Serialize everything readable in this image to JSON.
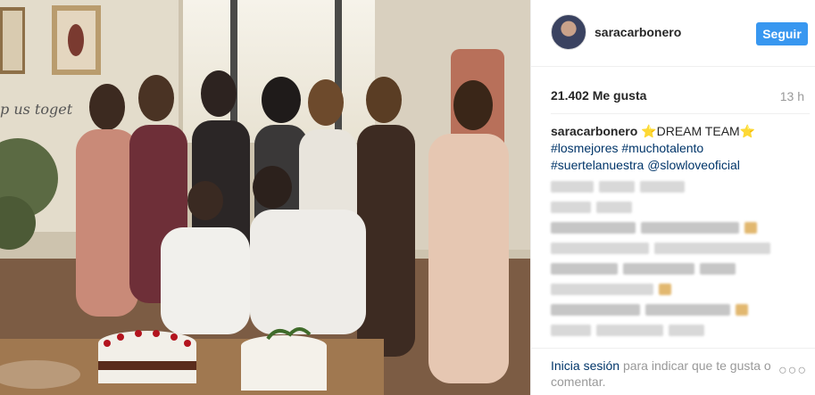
{
  "post": {
    "username": "saracarbonero",
    "follow_label": "Seguir",
    "likes": "21.402 Me gusta",
    "time": "13 h",
    "caption": {
      "user": "saracarbonero",
      "star_left": "⭐",
      "title": "DREAM TEAM",
      "star_right": "⭐",
      "tags": [
        "#losmejores",
        "#muchotalento",
        "#suertelanuestra"
      ],
      "mention": "@slowloveoficial"
    },
    "photo_sign_text": "p us toget"
  },
  "footer": {
    "login_link": "Inicia sesión",
    "login_rest": "para indicar que te gusta o comentar.",
    "more": "○○○"
  },
  "colors": {
    "follow_button": "#3897f0",
    "link": "#003569",
    "muted": "#999999"
  },
  "icons": {
    "avatar": "profile-avatar",
    "more": "more-options-icon"
  }
}
